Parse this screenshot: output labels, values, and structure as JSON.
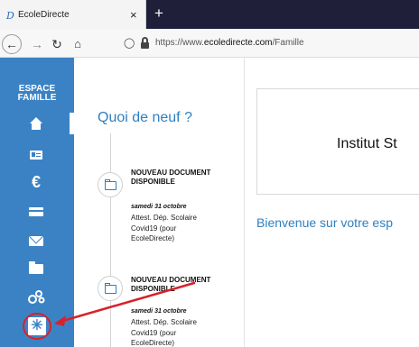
{
  "browser": {
    "tab_favicon": "D",
    "tab_title": "EcoleDirecte",
    "tab_close": "×",
    "new_tab": "+",
    "url_prefix": "https://www.",
    "url_domain": "ecoledirecte.com",
    "url_path": "/Famille"
  },
  "sidebar": {
    "title_line1": "ESPACE",
    "title_line2": "FAMILLE",
    "items": [
      {
        "icon": "home-icon",
        "active": true
      },
      {
        "icon": "id-card-icon"
      },
      {
        "icon": "euro-icon",
        "glyph": "€"
      },
      {
        "icon": "wallet-icon"
      },
      {
        "icon": "mail-icon"
      },
      {
        "icon": "folder-icon"
      },
      {
        "icon": "people-icon",
        "glyph": "o͟8"
      },
      {
        "icon": "snowflake-icon",
        "glyph": "✳",
        "highlighted": true
      }
    ],
    "highlight_color": "#d8212a"
  },
  "news": {
    "heading": "Quoi de neuf ?",
    "items": [
      {
        "title": "NOUVEAU DOCUMENT DISPONIBLE",
        "date": "samedi 31 octobre",
        "body": "Attest. Dép. Scolaire Covid19 (pour EcoleDirecte)"
      },
      {
        "title": "NOUVEAU DOCUMENT DISPONIBLE",
        "date": "samedi 31 octobre",
        "body": "Attest. Dép. Scolaire Covid19 (pour EcoleDirecte)"
      }
    ]
  },
  "school": {
    "name": "Institut St"
  },
  "welcome_text": "Bienvenue sur votre esp",
  "colors": {
    "brand_blue": "#3b82c4",
    "link_blue": "#2f7fbf",
    "annotation_red": "#d8212a"
  }
}
